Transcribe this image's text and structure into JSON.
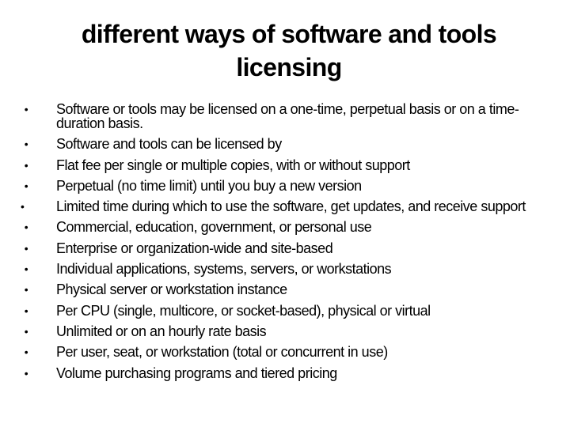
{
  "slide": {
    "title": "different ways of software and tools licensing",
    "bullet_icon": "•",
    "bullets": [
      "Software or tools may be licensed on a one-time, perpetual basis or on a time-duration basis.",
      "Software and tools can be licensed by",
      "Flat fee per single or multiple copies, with or without support",
      "Perpetual (no time limit) until you buy a new version",
      "Limited time during which to use the software, get updates, and receive support",
      "Commercial, education, government, or personal use",
      "Enterprise or organization-wide and site-based",
      "Individual applications, systems, servers, or workstations",
      "Physical server or workstation instance",
      "Per CPU (single, multicore, or socket-based), physical or virtual",
      "Unlimited or on an hourly rate basis",
      "Per user, seat, or workstation (total or concurrent in use)",
      "Volume purchasing programs and tiered pricing"
    ]
  }
}
